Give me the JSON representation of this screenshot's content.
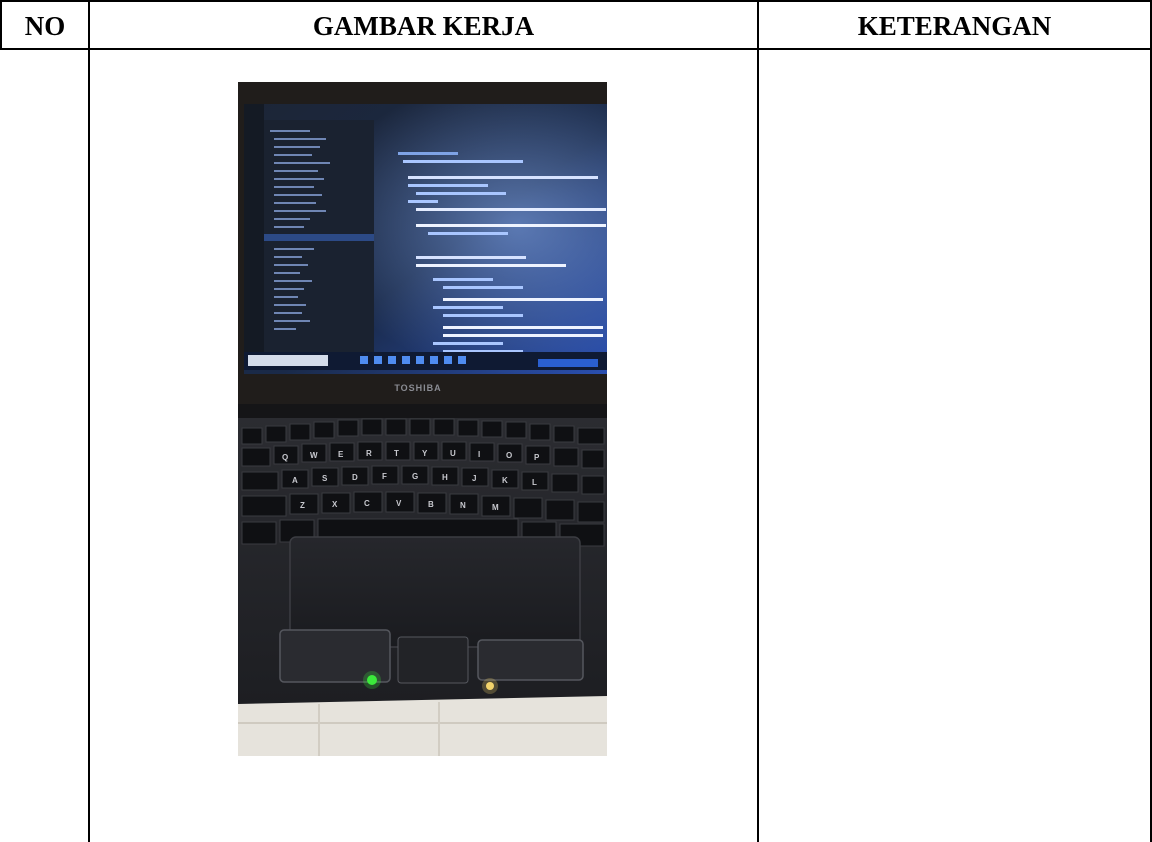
{
  "table": {
    "headers": {
      "no": "NO",
      "gambar_kerja": "GAMBAR KERJA",
      "keterangan": "KETERANGAN"
    },
    "rows": [
      {
        "no": "",
        "photo": {
          "laptop_brand_label": "TOSHIBA"
        },
        "keterangan": ""
      }
    ]
  }
}
